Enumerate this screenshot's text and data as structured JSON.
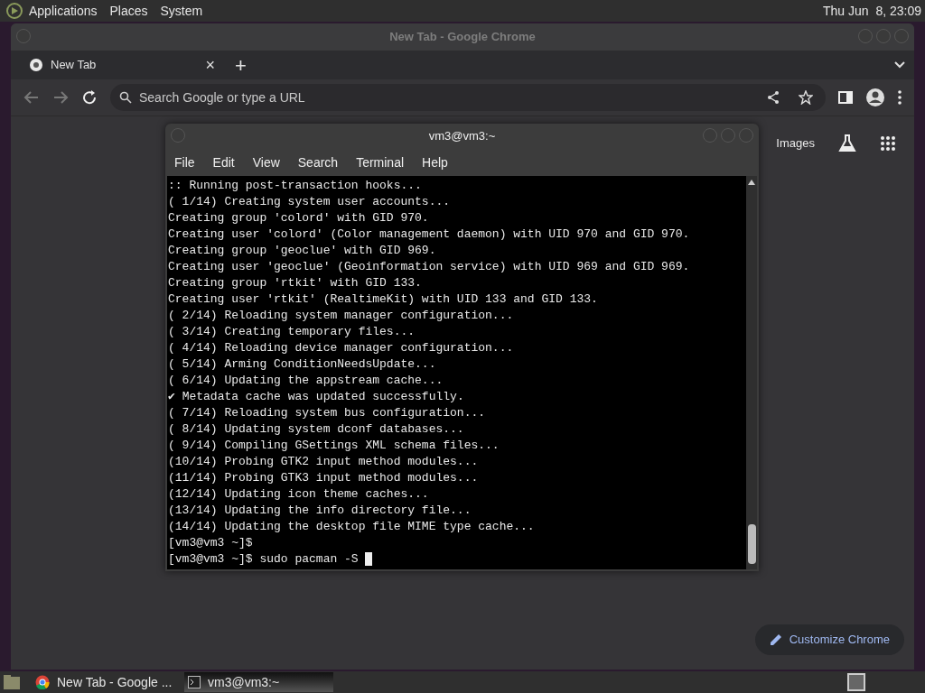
{
  "top_panel": {
    "menus": [
      "Applications",
      "Places",
      "System"
    ],
    "clock": "Thu Jun  8, 23:09"
  },
  "browser": {
    "title": "New Tab - Google Chrome",
    "tabs": [
      {
        "label": "New Tab",
        "selected": true
      }
    ],
    "close_tab": "×",
    "new_tab": "+",
    "omnibox": {
      "placeholder": "Search Google or type a URL"
    },
    "links": [
      "Images"
    ],
    "customize": "Customize Chrome"
  },
  "terminal": {
    "title": "vm3@vm3:~",
    "menus": [
      "File",
      "Edit",
      "View",
      "Search",
      "Terminal",
      "Help"
    ],
    "lines": [
      ":: Running post-transaction hooks...",
      "( 1/14) Creating system user accounts...",
      "Creating group 'colord' with GID 970.",
      "Creating user 'colord' (Color management daemon) with UID 970 and GID 970.",
      "Creating group 'geoclue' with GID 969.",
      "Creating user 'geoclue' (Geoinformation service) with UID 969 and GID 969.",
      "Creating group 'rtkit' with GID 133.",
      "Creating user 'rtkit' (RealtimeKit) with UID 133 and GID 133.",
      "( 2/14) Reloading system manager configuration...",
      "( 3/14) Creating temporary files...",
      "( 4/14) Reloading device manager configuration...",
      "( 5/14) Arming ConditionNeedsUpdate...",
      "( 6/14) Updating the appstream cache...",
      "✔ Metadata cache was updated successfully.",
      "( 7/14) Reloading system bus configuration...",
      "( 8/14) Updating system dconf databases...",
      "( 9/14) Compiling GSettings XML schema files...",
      "(10/14) Probing GTK2 input method modules...",
      "(11/14) Probing GTK3 input method modules...",
      "(12/14) Updating icon theme caches...",
      "(13/14) Updating the info directory file...",
      "(14/14) Updating the desktop file MIME type cache...",
      "[vm3@vm3 ~]$",
      "[vm3@vm3 ~]$ sudo pacman -S "
    ]
  },
  "taskbar": {
    "items": [
      {
        "kind": "browser",
        "label": "New Tab - Google ...",
        "selected": false
      },
      {
        "kind": "terminal",
        "label": "vm3@vm3:~",
        "selected": true
      }
    ]
  }
}
